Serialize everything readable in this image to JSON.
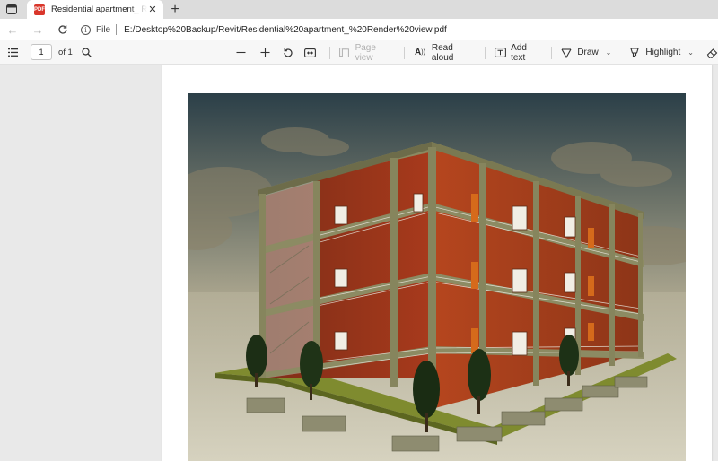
{
  "browser": {
    "tab": {
      "title": "Residential apartment_ Render view.pdf",
      "favicon": "pdf-icon"
    },
    "address": {
      "scheme_label": "File",
      "url": "E:/Desktop%20Backup/Revit/Residential%20apartment_%20Render%20view.pdf"
    }
  },
  "pdf_toolbar": {
    "page_number": "1",
    "page_count": "of 1",
    "page_view_label": "Page view",
    "read_aloud_label": "Read aloud",
    "add_text_label": "Add text",
    "draw_label": "Draw",
    "highlight_label": "Highlight"
  },
  "document": {
    "image": "rendered-residential-apartment-building",
    "colors": {
      "sky_top": "#2f434b",
      "ground": "#cfcab5",
      "brick": "#a9391c",
      "frame": "#7d7c58",
      "lawn": "#7e8a2e"
    }
  }
}
